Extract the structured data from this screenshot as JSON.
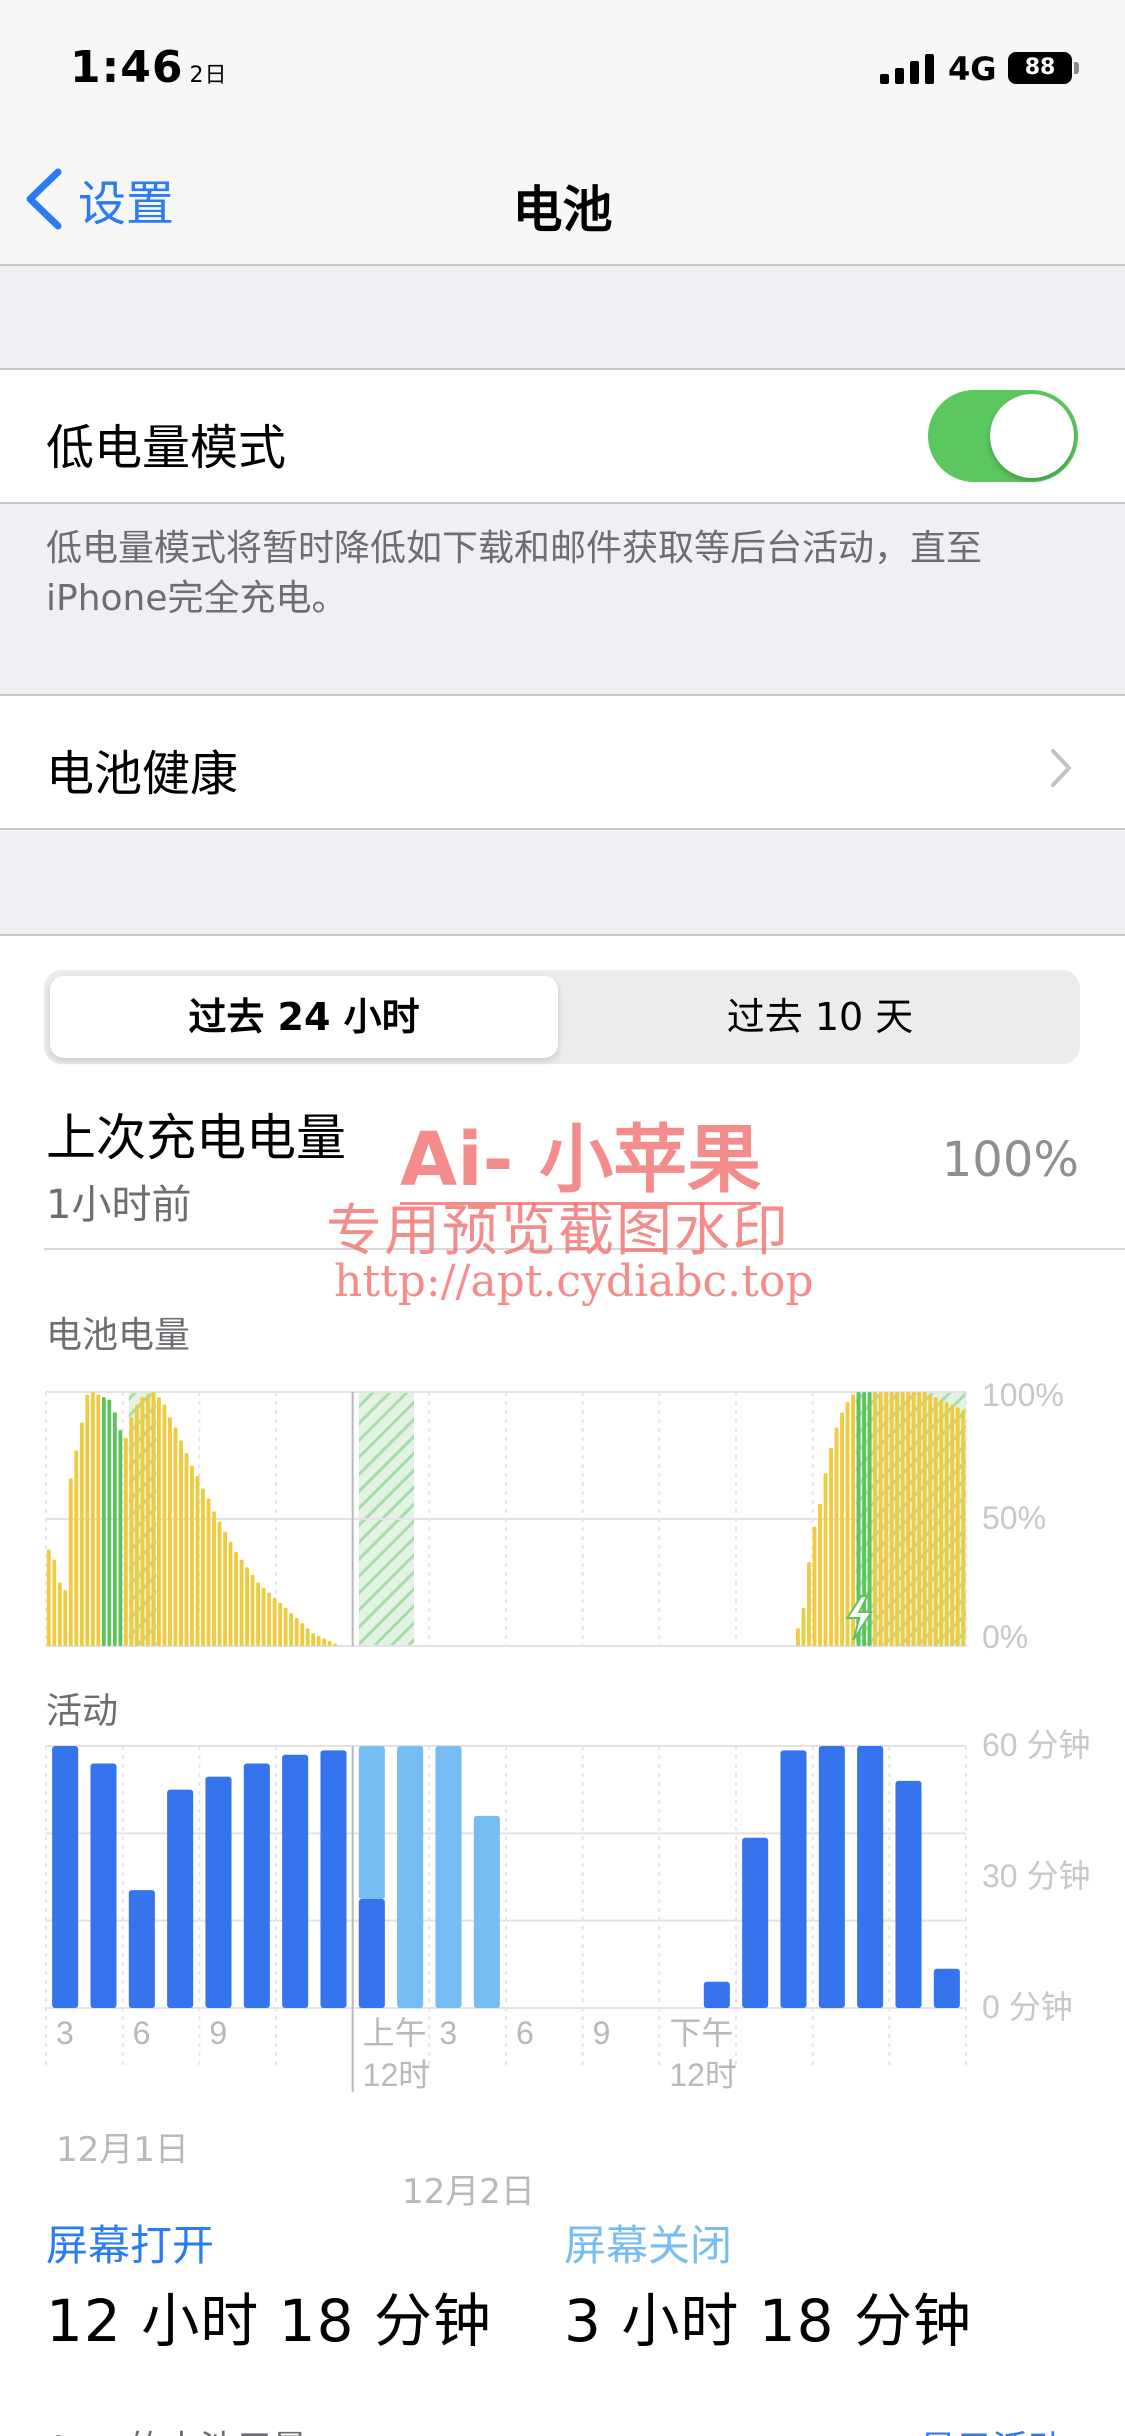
{
  "status_bar": {
    "time": "1:46",
    "date_mark": "2日",
    "network": "4G",
    "battery": "88"
  },
  "nav": {
    "back_label": "设置",
    "title": "电池"
  },
  "low_power": {
    "label": "低电量模式",
    "enabled": true,
    "footnote": "低电量模式将暂时降低如下载和邮件获取等后台活动，直至iPhone完全充电。"
  },
  "battery_health": {
    "label": "电池健康"
  },
  "segmented": {
    "options": [
      "过去 24 小时",
      "过去 10 天"
    ],
    "selected": 0
  },
  "last_charge": {
    "title": "上次充电电量",
    "subtitle": "1小时前",
    "value": "100%"
  },
  "watermark": {
    "line1": "Ai- 小苹果",
    "line2": "专用预览截图水印",
    "line3": "http://apt.cydiabc.top"
  },
  "colors": {
    "accent": "#2b7bf5",
    "battery_bar": "#f0cb40",
    "charging_bar": "#5ec35d",
    "screen_on": "#3574ec",
    "screen_off": "#75bdf3",
    "toggle_on": "#5ac85e"
  },
  "chart_data": [
    {
      "type": "bar",
      "title": "电池电量",
      "y_ticks": [
        "100%",
        "50%",
        "0%"
      ],
      "ylim": [
        0,
        100
      ],
      "bars": [
        38,
        34,
        25,
        22,
        66,
        77,
        88,
        99,
        100,
        99,
        98,
        97,
        92,
        85,
        82,
        90,
        95,
        98,
        99,
        100,
        98,
        95,
        90,
        86,
        81,
        76,
        71,
        67,
        62,
        58,
        53,
        49,
        45,
        41,
        37,
        34,
        31,
        28,
        25,
        23,
        21,
        19,
        17,
        15,
        13,
        11,
        9,
        7,
        5,
        4,
        3,
        2,
        1,
        0,
        0,
        0,
        0,
        0,
        0,
        0,
        0,
        0,
        0,
        0,
        0,
        0,
        0,
        0,
        0,
        0,
        0,
        0,
        0,
        0,
        0,
        0,
        0,
        0,
        0,
        0,
        0,
        0,
        0,
        0,
        0,
        0,
        0,
        0,
        0,
        0,
        0,
        0,
        0,
        0,
        0,
        0,
        0,
        0,
        0,
        0,
        0,
        0,
        0,
        0,
        0,
        0,
        0,
        0,
        0,
        0,
        0,
        0,
        0,
        0,
        0,
        0,
        0,
        0,
        0,
        0,
        0,
        0,
        0,
        0,
        0,
        0,
        0,
        0,
        0,
        0,
        0,
        0,
        0,
        0,
        0,
        0,
        7,
        15,
        33,
        47,
        56,
        68,
        78,
        86,
        92,
        96,
        99,
        100,
        100,
        100,
        100,
        100,
        100,
        100,
        100,
        100,
        100,
        100,
        100,
        100,
        99,
        98,
        97,
        96,
        95,
        94,
        93
      ],
      "charging_bars": [
        9,
        10,
        11,
        12,
        13,
        14,
        15,
        16,
        17,
        18,
        19,
        20,
        21,
        22,
        23,
        24,
        25,
        26,
        27,
        28,
        29,
        30,
        31,
        32,
        33,
        34,
        35,
        36,
        37,
        38,
        39,
        40,
        41,
        42,
        43,
        44,
        45,
        46,
        47,
        48,
        49,
        50,
        51,
        52,
        53,
        54,
        55,
        56,
        57,
        58,
        59,
        60,
        61,
        62,
        63,
        64,
        65,
        66,
        67,
        68,
        69,
        70,
        71,
        72,
        73,
        74,
        75,
        76,
        77,
        78,
        79,
        80,
        81,
        82,
        83,
        84,
        85,
        86,
        87,
        88,
        89,
        90,
        91,
        92,
        93,
        94,
        95,
        96,
        97,
        98,
        99,
        100,
        101,
        102,
        103,
        104,
        105,
        106,
        107,
        108,
        109,
        110,
        111,
        112,
        113,
        114,
        115,
        116,
        117,
        118,
        119,
        120,
        121,
        122,
        123,
        124,
        125,
        126,
        127,
        128,
        129,
        130,
        131,
        132,
        133,
        134,
        135,
        136,
        137,
        138,
        139,
        140,
        141,
        142,
        143,
        144
      ],
      "charge_periods": [
        [
          0.09,
          0.12
        ],
        [
          0.34,
          0.4
        ],
        [
          0.88,
          1.0
        ]
      ]
    },
    {
      "type": "bar",
      "title": "活动",
      "y_ticks": [
        "60 分钟",
        "30 分钟",
        "0 分钟"
      ],
      "ylim": [
        0,
        60
      ],
      "series": [
        {
          "name": "屏幕打开",
          "values": [
            60,
            56,
            27,
            50,
            53,
            56,
            58,
            59,
            25,
            0,
            0,
            0,
            0,
            0,
            0,
            0,
            0,
            6,
            39,
            59,
            60,
            60,
            52,
            9
          ]
        },
        {
          "name": "屏幕关闭",
          "values": [
            0,
            0,
            0,
            0,
            0,
            0,
            0,
            0,
            35,
            60,
            60,
            44,
            0,
            0,
            0,
            0,
            0,
            0,
            0,
            0,
            0,
            0,
            0,
            0
          ]
        }
      ],
      "x_ticks": [
        "3",
        "6",
        "9",
        "上午",
        "12时",
        "3",
        "6",
        "9",
        "下午",
        "12时"
      ],
      "date_labels": [
        "12月1日",
        "12月2日"
      ]
    }
  ],
  "chart_labels": {
    "battery_title": "电池电量",
    "battery_y": [
      "100%",
      "50%",
      "0%"
    ],
    "activity_title": "活动",
    "activity_y": [
      "60 分钟",
      "30 分钟",
      "0 分钟"
    ],
    "x_ticks": [
      "3",
      "6",
      "9",
      "上午",
      "12时",
      "3",
      "6",
      "9",
      "下午",
      "12时"
    ],
    "date_labels": [
      "12月1日",
      "12月2日"
    ]
  },
  "summary": {
    "screen_on_label": "屏幕打开",
    "screen_on_value": "12 小时 18 分钟",
    "screen_off_label": "屏幕关闭",
    "screen_off_value": "3 小时 18 分钟"
  },
  "app_usage": {
    "label": "App 的电池用量",
    "action": "显示活动"
  }
}
